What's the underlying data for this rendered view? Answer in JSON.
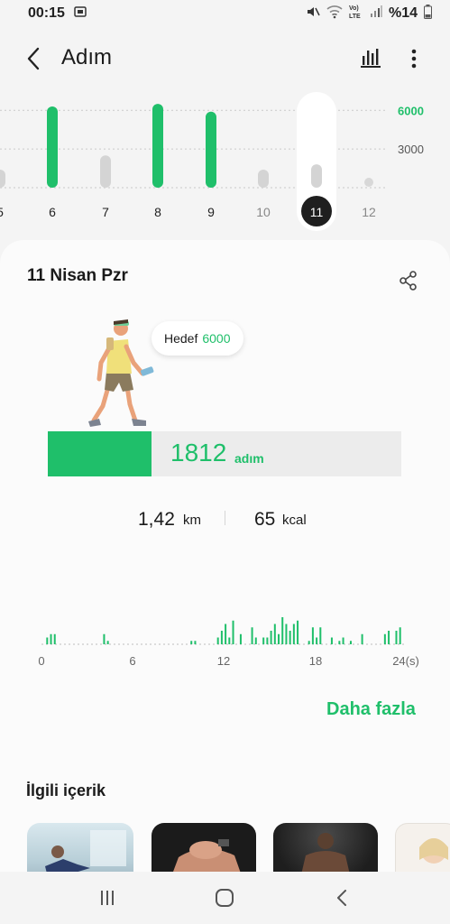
{
  "status_bar": {
    "time": "00:15",
    "battery": "%14",
    "network": "LTE",
    "volte": "Vo)"
  },
  "app_bar": {
    "title": "Adım"
  },
  "day_chart": {
    "gridline_labels": [
      "6000",
      "3000"
    ],
    "goal_label_color": "#1fbf6a",
    "days": [
      {
        "label": "5",
        "steps": 1400,
        "met_goal": false
      },
      {
        "label": "6",
        "steps": 6300,
        "met_goal": true
      },
      {
        "label": "7",
        "steps": 2500,
        "met_goal": false
      },
      {
        "label": "8",
        "steps": 6500,
        "met_goal": true
      },
      {
        "label": "9",
        "steps": 5900,
        "met_goal": true
      },
      {
        "label": "10",
        "steps": 1400,
        "met_goal": false
      },
      {
        "label": "11",
        "steps": 1812,
        "met_goal": false,
        "selected": true
      },
      {
        "label": "12",
        "steps": 0,
        "met_goal": false,
        "future": true
      }
    ],
    "max": 7000
  },
  "summary": {
    "date": "11 Nisan Pzr",
    "goal_label": "Hedef",
    "goal_value": "6000",
    "goal_steps": 6000,
    "steps": "1812",
    "steps_count": 1812,
    "steps_unit": "adım",
    "distance": "1,42",
    "distance_unit": "km",
    "calories": "65",
    "calories_unit": "kcal"
  },
  "hour_chart": {
    "x_ticks": [
      "0",
      "6",
      "12",
      "18",
      "24(s)"
    ],
    "bars_per_hour": 4,
    "values": [
      0,
      2,
      3,
      3,
      0,
      0,
      0,
      0,
      0,
      0,
      0,
      0,
      0,
      0,
      0,
      0,
      3,
      1,
      0,
      0,
      0,
      0,
      0,
      0,
      0,
      0,
      0,
      0,
      0,
      0,
      0,
      0,
      0,
      0,
      0,
      0,
      0,
      0,
      0,
      1,
      1,
      0,
      0,
      0,
      0,
      0,
      2,
      4,
      6,
      2,
      7,
      0,
      3,
      0,
      0,
      5,
      2,
      0,
      2,
      2,
      4,
      6,
      3,
      8,
      6,
      4,
      6,
      7,
      0,
      0,
      1,
      5,
      2,
      5,
      0,
      0,
      2,
      0,
      1,
      2,
      0,
      1,
      0,
      0,
      3,
      0,
      0,
      0,
      0,
      0,
      3,
      4,
      0,
      4,
      5,
      0
    ],
    "max": 8
  },
  "more_link": "Daha fazla",
  "related": {
    "title": "İlgili içerik"
  },
  "colors": {
    "accent": "#1fbf6a",
    "bar_inactive": "#d4d4d4"
  }
}
